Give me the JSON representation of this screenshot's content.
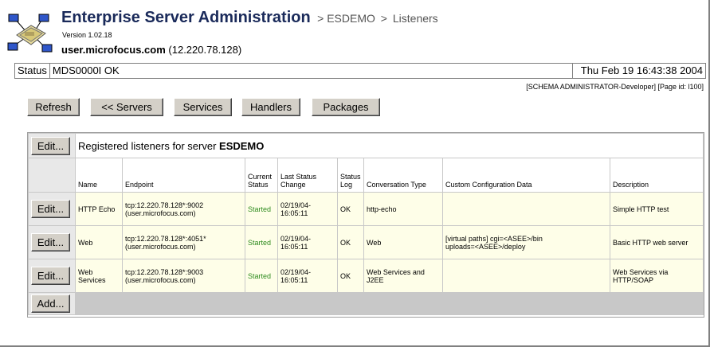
{
  "header": {
    "title": "Enterprise Server Administration",
    "breadcrumb": [
      ">",
      "ESDEMO",
      ">",
      "Listeners"
    ],
    "version": "Version 1.02.18",
    "host_name": "user.microfocus.com",
    "host_ip": "(12.220.78.128)"
  },
  "status": {
    "label": "Status",
    "message": "MDS0000I OK",
    "time": "Thu Feb 19 16:43:38 2004"
  },
  "role_info": "[SCHEMA ADMINISTRATOR-Developer] [Page id: l100]",
  "toolbar": {
    "refresh": "Refresh",
    "servers": "<< Servers",
    "services": "Services",
    "handlers": "Handlers",
    "packages": "Packages"
  },
  "listeners": {
    "edit_label": "Edit...",
    "add_label": "Add...",
    "caption_prefix": "Registered listeners for server",
    "server": "ESDEMO",
    "columns": {
      "name": "Name",
      "endpoint": "Endpoint",
      "current_status": "Current Status",
      "last_change": "Last Status Change",
      "status_log": "Status Log",
      "conv_type": "Conversation Type",
      "custom_config": "Custom Configuration Data",
      "description": "Description"
    },
    "rows": [
      {
        "name": "HTTP Echo",
        "endpoint_line1": "tcp:12.220.78.128*:9002",
        "endpoint_line2": "(user.microfocus.com)",
        "status": "Started",
        "change_date": "02/19/04-",
        "change_time": "16:05:11",
        "log": "OK",
        "conv_type": "http-echo",
        "config_line1": "",
        "config_line2": "",
        "description": "Simple HTTP test"
      },
      {
        "name": "Web",
        "endpoint_line1": "tcp:12.220.78.128*:4051*",
        "endpoint_line2": "(user.microfocus.com)",
        "status": "Started",
        "change_date": "02/19/04-",
        "change_time": "16:05:11",
        "log": "OK",
        "conv_type": "Web",
        "config_line1": "[virtual paths] cgi=<ASEE>/bin",
        "config_line2": "uploads=<ASEE>/deploy",
        "description": "Basic HTTP web server"
      },
      {
        "name": "Web Services",
        "endpoint_line1": "tcp:12.220.78.128*:9003",
        "endpoint_line2": "(user.microfocus.com)",
        "status": "Started",
        "change_date": "02/19/04-",
        "change_time": "16:05:11",
        "log": "OK",
        "conv_type": "Web Services and J2EE",
        "config_line1": "",
        "config_line2": "",
        "description": "Web Services via HTTP/SOAP"
      }
    ]
  }
}
